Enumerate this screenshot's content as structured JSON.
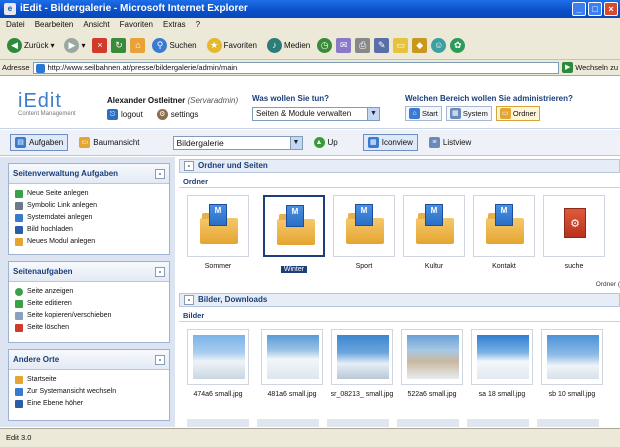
{
  "window": {
    "title": "iEdit - Bildergalerie - Microsoft Internet Explorer"
  },
  "menu": [
    "Datei",
    "Bearbeiten",
    "Ansicht",
    "Favoriten",
    "Extras",
    "?"
  ],
  "toolbar": {
    "back": "Zurück",
    "search": "Suchen",
    "favorites": "Favoriten",
    "media": "Medien"
  },
  "address": {
    "label": "Adresse",
    "url": "http://www.seilbahnen.at/presse/bildergalerie/admin/main",
    "go": "Wechseln zu"
  },
  "header": {
    "logo": "iEdit",
    "logo_sub": "Content Management",
    "user_name": "Alexander Ostleitner",
    "user_role": "(Servaradmin)",
    "logout": "logout",
    "settings": "settings",
    "question1": "Was wollen Sie tun?",
    "module_select": "Seiten & Module verwalten",
    "question2": "Welchen Bereich wollen Sie administrieren?",
    "areas": [
      "Start",
      "System",
      "Ordner"
    ]
  },
  "subbar": {
    "tab_tasks": "Aufgaben",
    "tab_tree": "Baumansicht",
    "gallery_select": "Bildergalerie",
    "up": "Up",
    "iconview": "Iconview",
    "listview": "Listview"
  },
  "sidebar": {
    "panel1": {
      "title": "Seitenverwaltung Aufgaben",
      "items": [
        "Neue Seite anlegen",
        "Symbolic Link anlegen",
        "Systemdatei anlegen",
        "Bild hochladen",
        "Neues Modul anlegen"
      ]
    },
    "panel2": {
      "title": "Seitenaufgaben",
      "items": [
        "Seite anzeigen",
        "Seite editieren",
        "Seite kopieren/verschieben",
        "Seite löschen"
      ]
    },
    "panel3": {
      "title": "Andere Orte",
      "items": [
        "Startseite",
        "Zur Systemansicht wechseln",
        "Eine Ebene höher"
      ]
    }
  },
  "main": {
    "sec1": "Ordner und Seiten",
    "sub1": "Ordner",
    "folders": [
      "Sommer",
      "Winter",
      "Sport",
      "Kultur",
      "Kontakt",
      "suche"
    ],
    "selected_folder": "Winter",
    "edge_label": "Ordner (",
    "sec2": "Bilder, Downloads",
    "sub2": "Bilder",
    "images": [
      "474a6 small.jpg",
      "481a6 small.jpg",
      "sr_08213_ small.jpg",
      "522a6 small.jpg",
      "sa 18 small.jpg",
      "sb 10 small.jpg"
    ]
  },
  "status": "Edit 3.0",
  "colors": {
    "accent": "#1c3f7a",
    "folder": "#e4a531",
    "titlebar": "#0a4fc7"
  }
}
